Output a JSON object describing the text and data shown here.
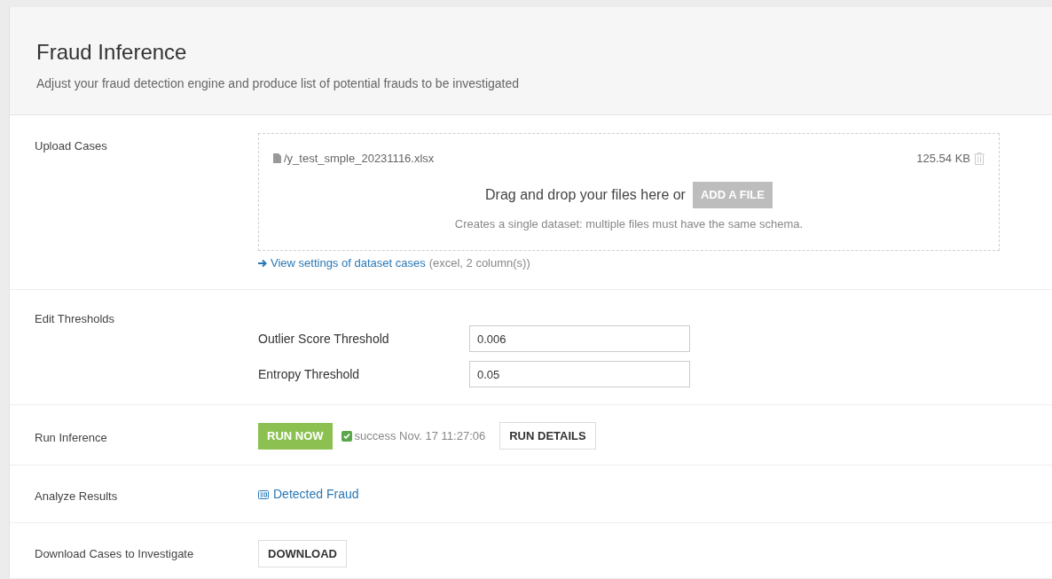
{
  "header": {
    "title": "Fraud Inference",
    "subtitle": "Adjust your fraud detection engine and produce list of potential frauds to be investigated"
  },
  "sections": [
    {
      "kind": "upload",
      "label": "Upload Cases",
      "file": {
        "name": "/y_test_smple_20231116.xlsx",
        "size": "125.54 KB"
      },
      "drop_text": "Drag and drop your files here or",
      "add_button": "ADD A FILE",
      "hint": "Creates a single dataset: multiple files must have the same schema.",
      "settings_link": "View settings of dataset cases",
      "settings_note": "(excel, 2 column(s))"
    },
    {
      "kind": "thresholds",
      "label": "Edit Thresholds",
      "fields": [
        {
          "label": "Outlier Score Threshold",
          "value": "0.006"
        },
        {
          "label": "Entropy Threshold",
          "value": "0.05"
        }
      ]
    },
    {
      "kind": "run",
      "label": "Run Inference",
      "run_button": "RUN NOW",
      "status": "success Nov. 17 11:27:06",
      "succeeded": true,
      "details_button": "RUN DETAILS"
    },
    {
      "kind": "link",
      "label": "Analyze Results",
      "link": "Detected Fraud"
    },
    {
      "kind": "button",
      "label": "Download Cases to Investigate",
      "button": "DOWNLOAD"
    }
  ]
}
